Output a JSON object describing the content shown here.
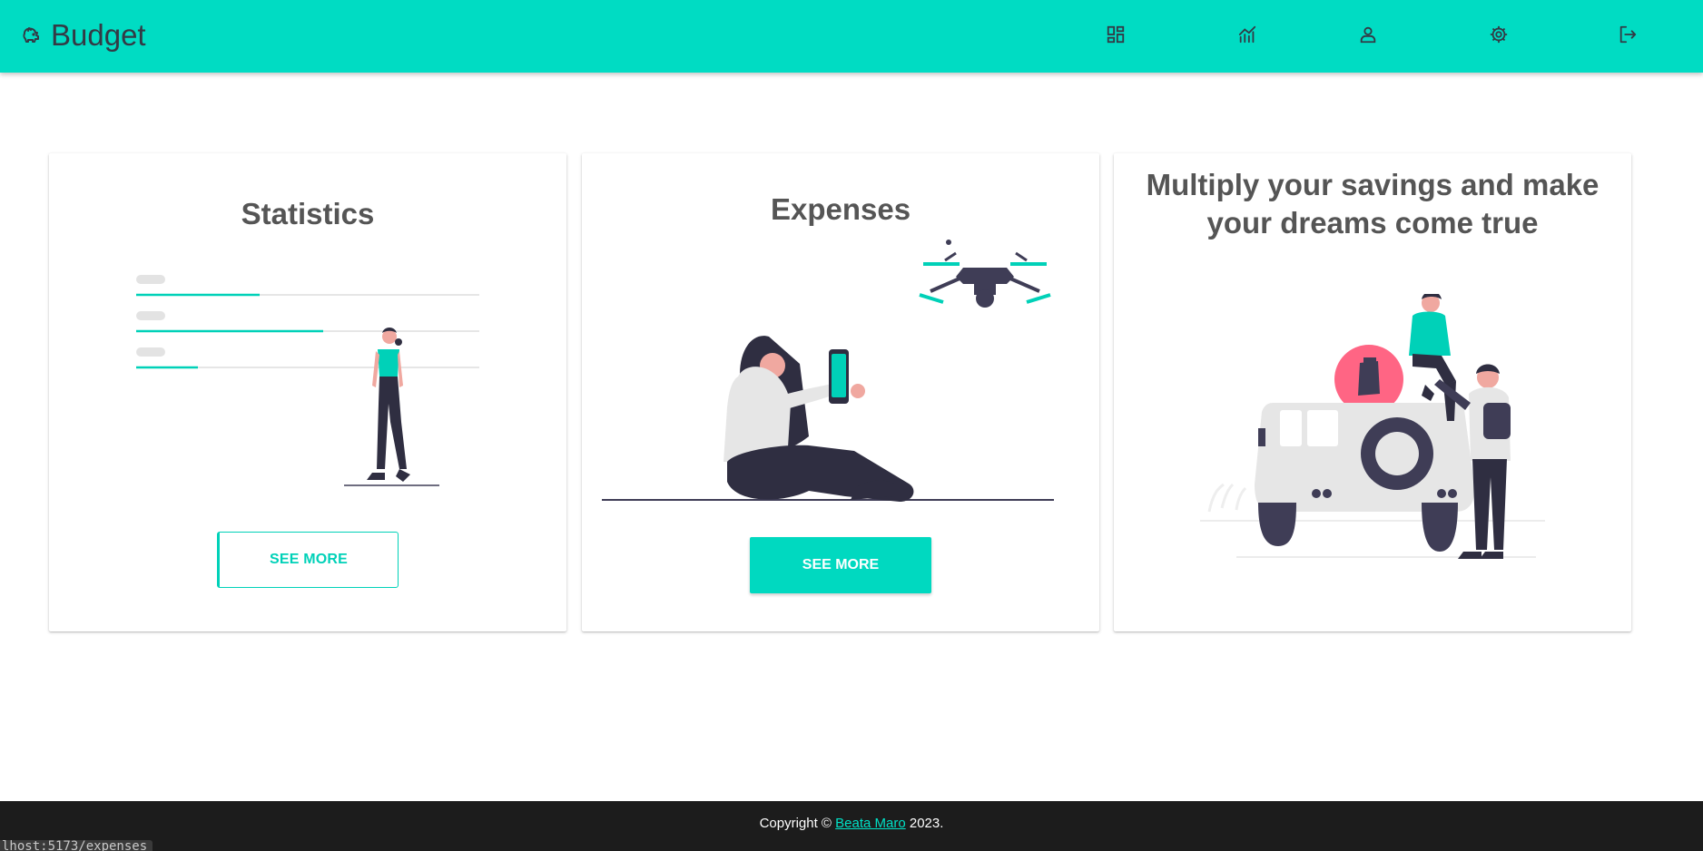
{
  "app": {
    "title": "Budget",
    "logo_icon": "piggy-bank-icon",
    "accent_color": "#00dcc3",
    "dark_color": "#333a45"
  },
  "nav": [
    {
      "icon": "dashboard-icon"
    },
    {
      "icon": "chart-icon"
    },
    {
      "icon": "user-icon"
    },
    {
      "icon": "gear-icon"
    },
    {
      "icon": "logout-icon"
    }
  ],
  "cards": {
    "statistics": {
      "title": "Statistics",
      "button": "SEE MORE"
    },
    "expenses": {
      "title": "Expenses",
      "button": "SEE MORE"
    },
    "savings": {
      "title": "Multiply your savings and make your dreams come true"
    }
  },
  "footer": {
    "prefix": "Copyright © ",
    "author": "Beata Maro",
    "suffix": " 2023."
  },
  "status_bar": {
    "url": "lhost:5173/expenses"
  }
}
